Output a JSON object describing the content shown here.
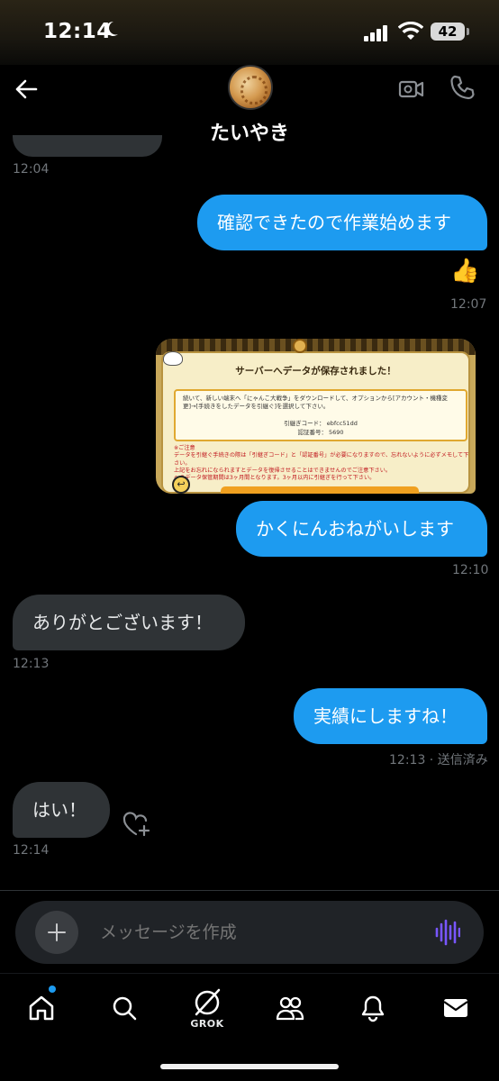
{
  "status_bar": {
    "time": "12:14",
    "battery": "42"
  },
  "header": {
    "contact_name": "たいやき"
  },
  "messages": {
    "ts_0": "12:04",
    "msg_1": "確認できたので作業始めます",
    "reaction_1": "👍",
    "ts_1": "12:07",
    "image": {
      "title": "サーバーへデータが保存されました！",
      "instructions": "続いて、新しい端末へ「にゃんこ大戦争」をダウンロードして、オプションから[アカウント・機種変更]→[手続きをしたデータを引継ぐ]を選択して下さい。",
      "code_label": "引継ぎコード： ebfcc51dd",
      "pin_label": "認証番号： 5690",
      "notes": "※ご注意\nデータを引継ぐ手続きの際は「引継ぎコード」と「認証番号」が必要になりますので、忘れないように必ずメモして下さい。\n上記をお忘れになられますとデータを復帰させることはできませんのでご注意下さい。\nへのデータ保管期間は3ヶ月間となります。3ヶ月以内に引継ぎを行って下さい。"
    },
    "msg_2": "かくにんおねがいします",
    "ts_2": "12:10",
    "msg_3": "ありがとございます！",
    "ts_3": "12:13",
    "msg_4": "実績にしますね！",
    "ts_4": "12:13 · 送信済み",
    "msg_5": "はい！",
    "ts_5": "12:14"
  },
  "composer": {
    "placeholder": "メッセージを作成"
  },
  "nav": {
    "grok_label": "GROK"
  },
  "colors": {
    "accent": "#1d9bf0",
    "incoming_bubble": "#2f3336",
    "voice": "#7856ff"
  }
}
